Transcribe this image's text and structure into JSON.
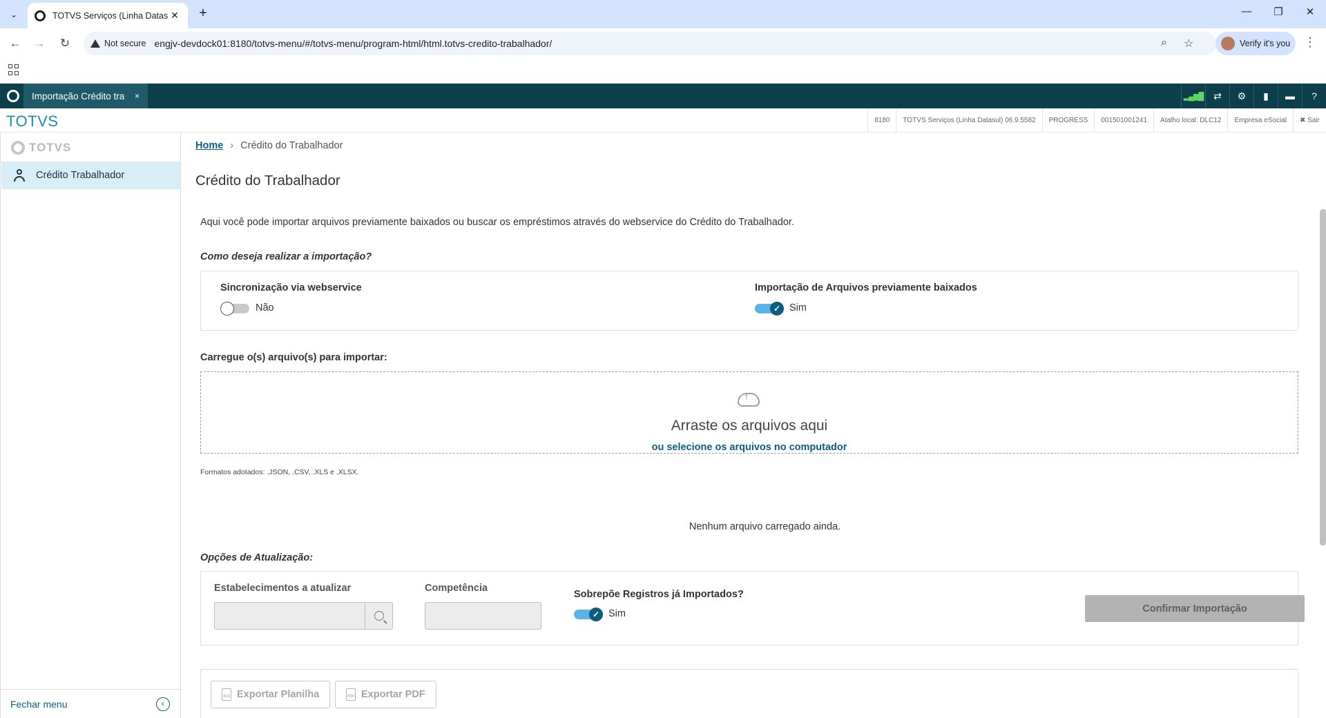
{
  "browser": {
    "tab_title": "TOTVS Serviços (Linha Datasul)",
    "security_label": "Not secure",
    "url": "engjv-devdock01:8180/totvs-menu/#/totvs-menu/program-html/html.totvs-credito-trabalhador/",
    "verify_label": "Verify it's you"
  },
  "appbar": {
    "tab_label": "Importação Crédito tra",
    "tab_close": "×"
  },
  "brandbar": {
    "brand": "TOTVS",
    "info": [
      "8180",
      "TOTVS Serviços (Linha Datasul) 06.9.5582",
      "PROGRESS",
      "001501001241",
      "Atalho local: DLC12",
      "Empresa eSocial",
      "Sair"
    ]
  },
  "sidebar": {
    "logo_text": "TOTVS",
    "items": [
      {
        "label": "Crédito Trabalhador"
      }
    ],
    "footer_label": "Fechar menu"
  },
  "breadcrumb": {
    "home": "Home",
    "current": "Crédito do Trabalhador"
  },
  "page": {
    "title": "Crédito do Trabalhador",
    "intro": "Aqui você pode importar arquivos previamente baixados ou buscar os empréstimos através do webservice do Crédito do Trabalhador.",
    "import_question": "Como deseja realizar a importação?",
    "webservice": {
      "label": "Sincronização via webservice",
      "state": "Não"
    },
    "files": {
      "label": "Importação de Arquivos previamente baixados",
      "state": "Sim"
    },
    "upload_label": "Carregue o(s) arquivo(s) para importar:",
    "drop_title": "Arraste os arquivos aqui",
    "drop_link": "ou selecione os arquivos no computador",
    "formats": "Formatos adotados: .JSON, .CSV, .XLS e .XLSX.",
    "no_files": "Nenhum arquivo carregado ainda.",
    "update_options": "Opções de Atualização:",
    "establishments_label": "Estabelecimentos a atualizar",
    "competencia_label": "Competência",
    "overwrite_label": "Sobrepõe Registros já Importados?",
    "overwrite_state": "Sim",
    "confirm_button": "Confirmar Importação",
    "export_sheet": "Exportar Planilha",
    "export_pdf": "Exportar PDF"
  },
  "colors": {
    "appbar": "#0d3e4c",
    "brand": "#1a8bb8",
    "accent": "#0c5d80",
    "switch_on": "#59b3e6"
  }
}
